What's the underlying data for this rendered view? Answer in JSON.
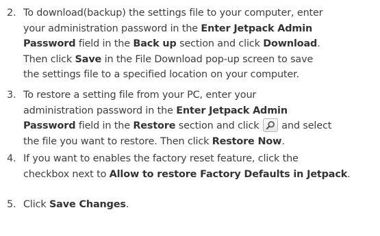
{
  "steps": [
    {
      "number": "2.",
      "lines": [
        [
          "To download(backup) the settings file to your computer, enter"
        ],
        [
          "your administration password in the ",
          {
            "b": "Enter Jetpack Admin"
          }
        ],
        [
          {
            "b": "Password"
          },
          " field in the ",
          {
            "b": "Back up"
          },
          " section and click ",
          {
            "b": "Download"
          },
          "."
        ],
        [
          "Then click ",
          {
            "b": "Save"
          },
          " in the File Download pop-up screen to save"
        ],
        [
          "the settings file to a specified location on your computer."
        ]
      ]
    },
    {
      "number": "3.",
      "lines": [
        [
          "To restore a setting file from your PC, enter your"
        ],
        [
          "administration password in the ",
          {
            "b": "Enter Jetpack Admin"
          }
        ],
        [
          {
            "b": "Password"
          },
          " field in the ",
          {
            "b": "Restore"
          },
          " section and click ",
          {
            "icon": "search-icon"
          },
          " and select"
        ],
        [
          "the file you want to restore. Then click ",
          {
            "b": "Restore Now"
          },
          "."
        ]
      ]
    },
    {
      "number": "4.",
      "lines": [
        [
          "If you want to enables the factory reset feature, click the"
        ],
        [
          "checkbox next to ",
          {
            "b": "Allow to restore Factory Defaults in Jetpack"
          },
          "."
        ]
      ]
    },
    {
      "number": "5.",
      "lines": [
        [
          "Click ",
          {
            "b": "Save Changes"
          },
          "."
        ]
      ]
    }
  ]
}
